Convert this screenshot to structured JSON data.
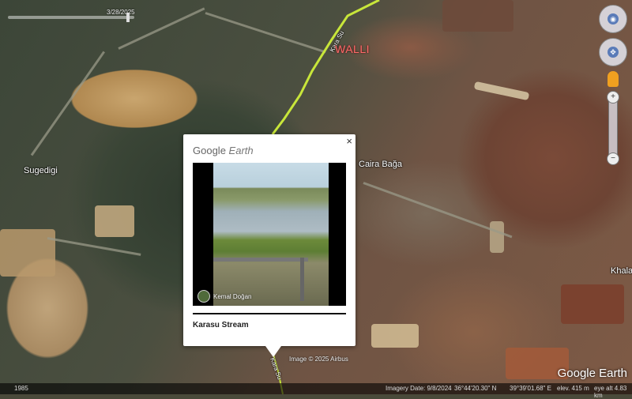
{
  "timeline": {
    "date": "3/28/2025"
  },
  "map_labels": {
    "walli": "WALLI",
    "sugedigi": "Sugedigi",
    "caira_baga": "Caira Bağa",
    "khala": "Khala",
    "road_upper": "Kara Su",
    "road_lower": "Kara Su"
  },
  "popup": {
    "brand_main": "Google",
    "brand_sub": "Earth",
    "close_label": "×",
    "author": "Kemal Doğan",
    "caption": "Karasu Stream"
  },
  "copyright": "Image © 2025 Airbus",
  "watermark": "Google Earth",
  "status_bar": {
    "year": "1985",
    "imagery_date": "Imagery Date: 9/8/2024",
    "latitude": "36°44'20.30\" N",
    "longitude": "39°39'01.68\" E",
    "elevation": "elev.  415 m",
    "eye_alt": "eye alt  4.83 km"
  },
  "nav": {
    "look_icon": "eye-icon",
    "move_icon": "move-icon",
    "zoom_in": "+",
    "zoom_out": "−"
  }
}
